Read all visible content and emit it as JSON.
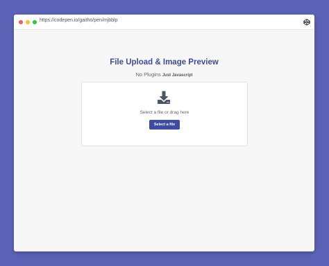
{
  "browser": {
    "url": "https://codepen.io/gaitho/pen/mjbblp",
    "icon": "codepen-icon",
    "window_controls": [
      {
        "name": "close",
        "color": "#f25f57"
      },
      {
        "name": "minimize",
        "color": "#fbbc2e"
      },
      {
        "name": "maximize",
        "color": "#2bc840"
      }
    ]
  },
  "page": {
    "title": "File Upload & Image Preview",
    "subtitle_main": "No Plugins",
    "subtitle_small": "Just Javascript"
  },
  "upload": {
    "icon": "download-icon",
    "hint": "Select a file or drag here",
    "button_label": "Select a file"
  },
  "colors": {
    "background": "#5b62b5",
    "accent": "#3f4aa1",
    "title": "#404a9a",
    "icon": "#4a5568"
  }
}
